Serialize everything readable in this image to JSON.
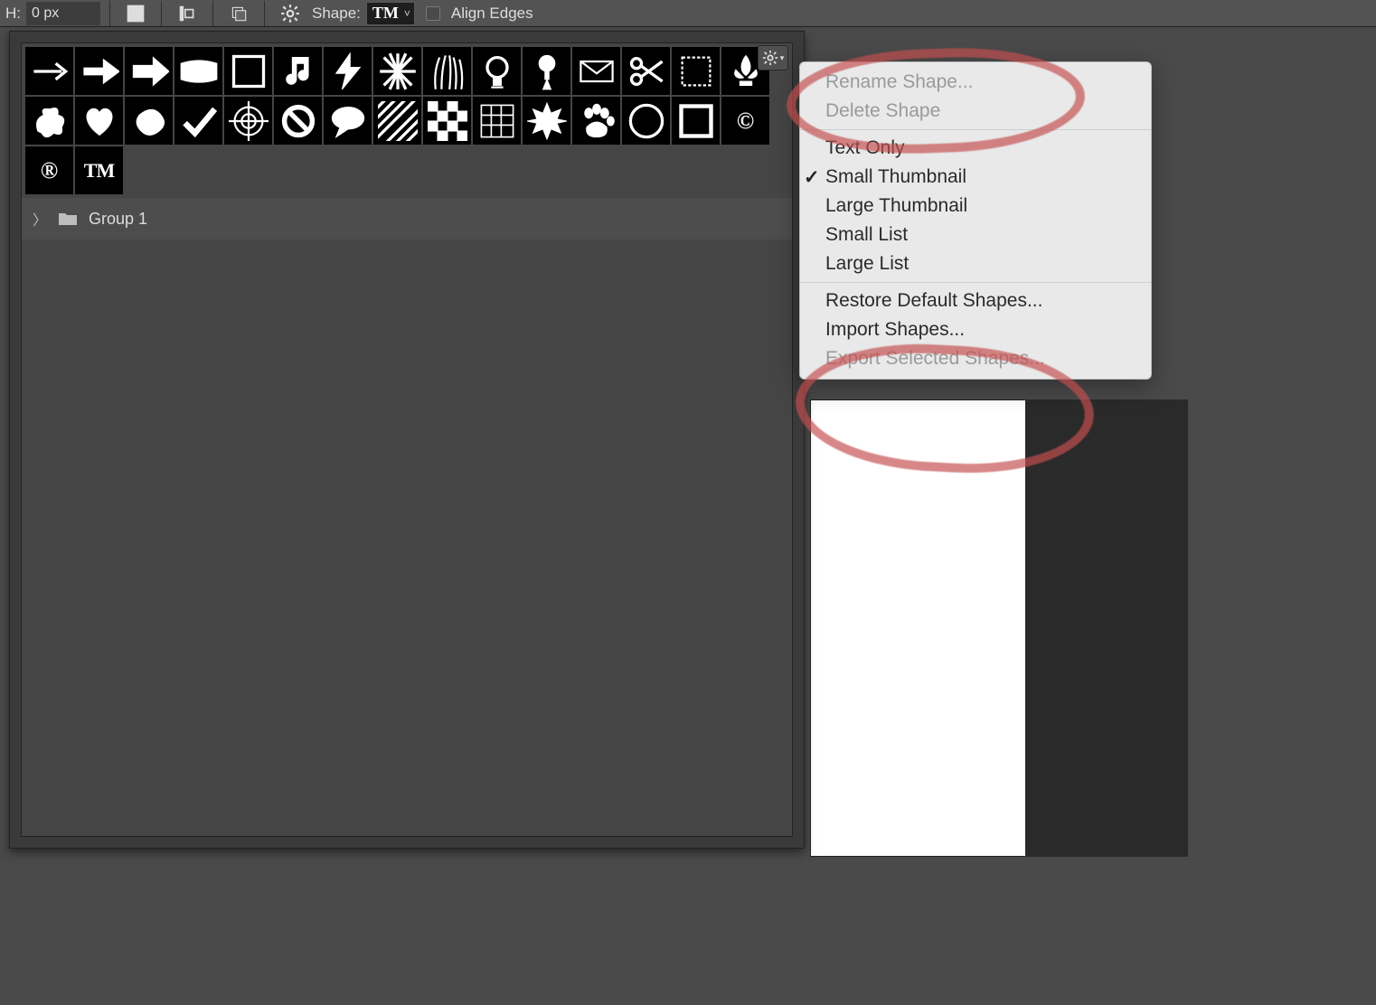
{
  "toolbar": {
    "h_label": "H:",
    "h_value": "0 px",
    "shape_label": "Shape:",
    "shape_swatch_text": "TM",
    "align_edges_label": "Align Edges"
  },
  "shapes_panel": {
    "group_name": "Group 1",
    "shapes": [
      "arrow-thin",
      "arrow-bold",
      "arrow-block",
      "banner",
      "frame",
      "music-note",
      "lightning",
      "burst-star",
      "grass",
      "bulb",
      "pushpin",
      "envelope",
      "scissors",
      "stamp",
      "fleur-de-lis",
      "floral",
      "heart",
      "blob",
      "checkmark",
      "crosshair",
      "no-symbol",
      "speech-bubble",
      "diagonal-lines",
      "checker",
      "grid",
      "starburst",
      "paw",
      "circle-outline",
      "square-outline",
      "copyright",
      "registered",
      "trademark"
    ]
  },
  "flyout": {
    "rename": "Rename Shape...",
    "delete": "Delete Shape",
    "text_only": "Text Only",
    "small_thumb": "Small Thumbnail",
    "large_thumb": "Large Thumbnail",
    "small_list": "Small List",
    "large_list": "Large List",
    "restore": "Restore Default Shapes...",
    "import": "Import Shapes...",
    "export": "Export Selected Shapes...",
    "selected_view": "small_thumb"
  }
}
